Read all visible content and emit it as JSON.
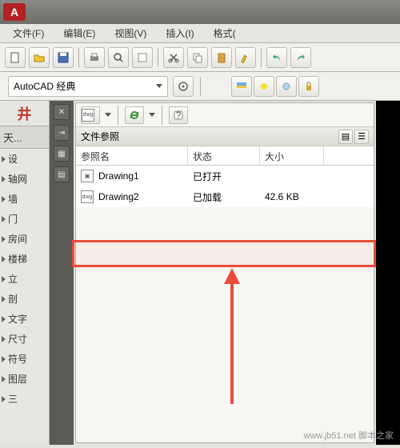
{
  "logo": "A",
  "menu": [
    "文件(F)",
    "编辑(E)",
    "视图(V)",
    "插入(I)",
    "格式("
  ],
  "workspace": "AutoCAD 经典",
  "leftTab": "天...",
  "tree": [
    "设",
    "轴网",
    "墙",
    "门",
    "房间",
    "楼梯",
    "立",
    "剖",
    "文字",
    "尺寸",
    "符号",
    "图层",
    "三"
  ],
  "panel": {
    "title": "文件参照",
    "cols": [
      "参照名",
      "状态",
      "大小"
    ],
    "rows": [
      {
        "name": "Drawing1",
        "status": "已打开",
        "size": ""
      },
      {
        "name": "Drawing2",
        "status": "已加载",
        "size": "42.6 KB"
      }
    ]
  },
  "watermark": "www.jb51.net 脚本之家"
}
